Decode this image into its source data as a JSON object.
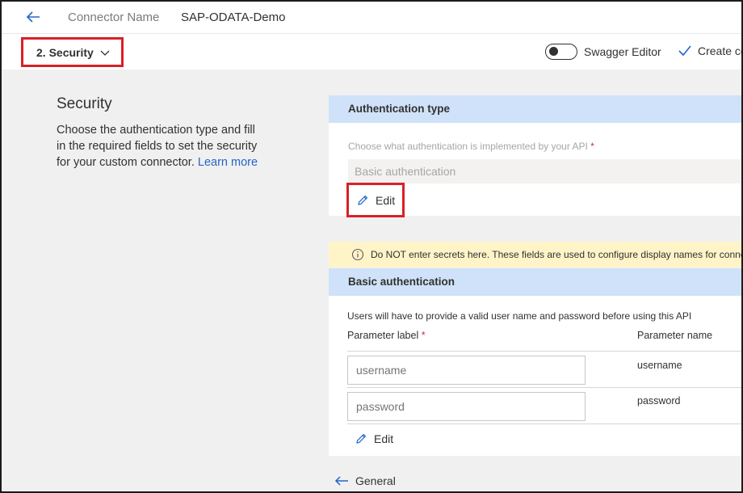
{
  "header": {
    "connector_name_label": "Connector Name",
    "connector_name_value": "SAP-ODATA-Demo"
  },
  "toolbar": {
    "step_label": "2. Security",
    "swagger_label": "Swagger Editor",
    "swagger_on": false,
    "create_label": "Create connector"
  },
  "section": {
    "title": "Security",
    "description": "Choose the authentication type and fill in the required fields to set the security for your custom connector.",
    "learn_more": "Learn more"
  },
  "auth_type": {
    "header": "Authentication type",
    "prompt": "Choose what authentication is implemented by your API",
    "required_mark": "*",
    "selected_value": "Basic authentication",
    "edit_label": "Edit"
  },
  "warning": {
    "text": "Do NOT enter secrets here. These fields are used to configure display names for connection parameters."
  },
  "basic_auth": {
    "header": "Basic authentication",
    "description": "Users will have to provide a valid user name and password before using this API",
    "col_label": "Parameter label",
    "col_required": "*",
    "col_name": "Parameter name",
    "rows": [
      {
        "label_placeholder": "username",
        "name": "username"
      },
      {
        "label_placeholder": "password",
        "name": "password"
      }
    ],
    "edit_label": "Edit"
  },
  "footer": {
    "back_label": "General"
  },
  "colors": {
    "accent_blue": "#2266c8",
    "highlight_red": "#d92027",
    "panel_header": "#cfe2f9",
    "warning_bg": "#fef4c8"
  }
}
